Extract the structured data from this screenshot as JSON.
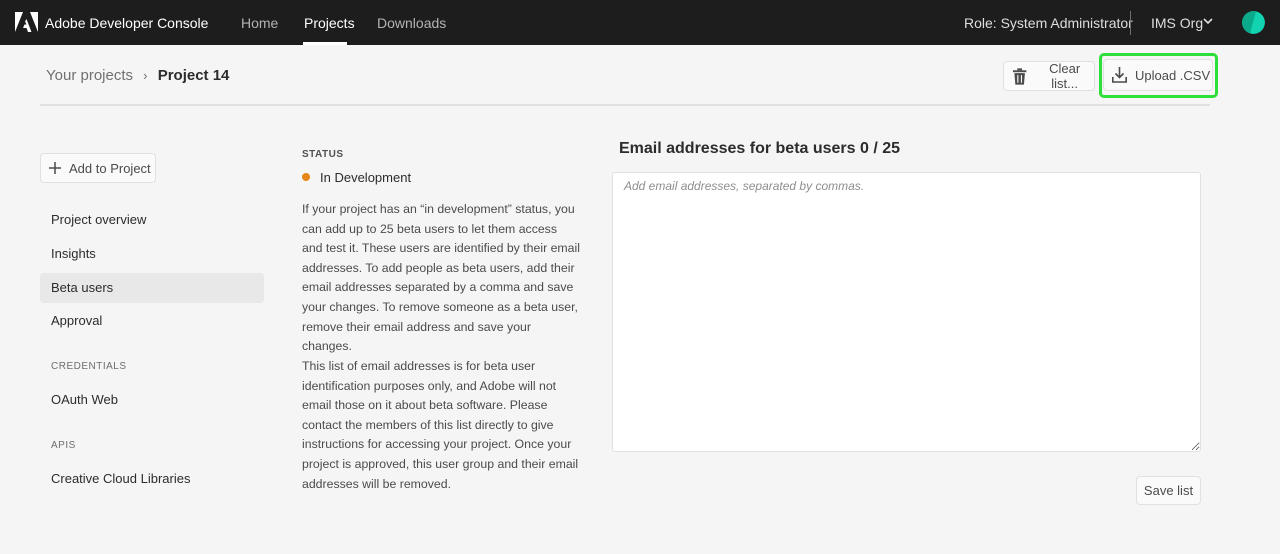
{
  "topbar": {
    "app_title": "Adobe Developer Console",
    "nav": [
      {
        "label": "Home",
        "active": false
      },
      {
        "label": "Projects",
        "active": true
      },
      {
        "label": "Downloads",
        "active": false
      }
    ],
    "role": "Role: System Administrator",
    "org": "IMS Org",
    "icons": {
      "logo": "adobe-logo",
      "org_dropdown": "chevron-down-icon",
      "avatar": "user-avatar"
    },
    "colors": {
      "avatar_primary": "#12d3b0",
      "avatar_secondary": "#0aa98b",
      "background": "#1d1d1d"
    }
  },
  "breadcrumb": {
    "parent": "Your projects",
    "separator": "›",
    "current": "Project 14"
  },
  "toolbar": {
    "clear_label": "Clear list...",
    "upload_label": "Upload .CSV",
    "highlight_color": "#2ddf3a"
  },
  "sidebar": {
    "add_button": "Add to Project",
    "items": [
      {
        "label": "Project overview",
        "selected": false
      },
      {
        "label": "Insights",
        "selected": false
      },
      {
        "label": "Beta users",
        "selected": true
      },
      {
        "label": "Approval",
        "selected": false
      }
    ],
    "sections": [
      {
        "heading": "CREDENTIALS",
        "items": [
          {
            "label": "OAuth Web"
          }
        ]
      },
      {
        "heading": "APIS",
        "items": [
          {
            "label": "Creative Cloud Libraries"
          }
        ]
      }
    ]
  },
  "status": {
    "label": "STATUS",
    "value": "In Development",
    "color": "#e68619"
  },
  "description": {
    "paragraph1": "If your project has an “in development” status, you can add up to 25 beta users to let them access and test it. These users are identified by their email addresses. To add people as beta users, add their email addresses separated by a comma and save your changes. To remove someone as a beta user, remove their email address and save your changes.",
    "paragraph2": "This list of email addresses is for beta user identification purposes only, and Adobe will not email those on it about beta software. Please contact the members of this list directly to give instructions for accessing your project. Once your project is approved, this user group and their email addresses will be removed."
  },
  "email": {
    "title": "Email addresses for beta users 0 / 25",
    "count": 0,
    "max": 25,
    "value": "",
    "placeholder": "Add email addresses, separated by commas.",
    "save_label": "Save list"
  }
}
